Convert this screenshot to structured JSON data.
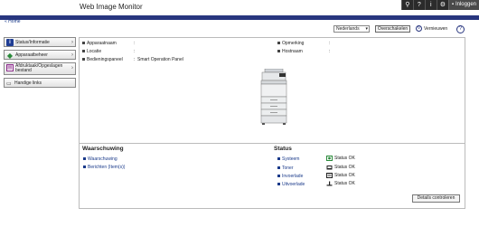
{
  "header": {
    "app_title": "Web Image Monitor",
    "icons": [
      "search-icon",
      "question-icon",
      "info-icon",
      "gear-icon",
      "user-icon"
    ],
    "login_label": "Inloggen"
  },
  "breadcrumb": {
    "home_label": "Home"
  },
  "toolbar": {
    "language": "Nederlands",
    "switch_label": "Overschakelen",
    "refresh_label": "Vernieuwen",
    "help_icon": "help-icon"
  },
  "sidebar": {
    "items": [
      {
        "label": "Status/Informatie",
        "icon": "info-icon"
      },
      {
        "label": "Apparaatbeheer",
        "icon": "device-icon"
      },
      {
        "label": "Afdruktaak/Opgeslagen bestand",
        "icon": "print-job-icon"
      }
    ],
    "links_label": "Handige links"
  },
  "device_info": {
    "rows": [
      {
        "label": "Apparaatnaam",
        "sep": ":",
        "value": ""
      },
      {
        "label": "Locatie",
        "sep": ":",
        "value": ""
      },
      {
        "label": "Bedieningspaneel",
        "sep": ":",
        "value": "Smart Operation Panel"
      },
      {
        "label": "Opmerking",
        "sep": ":",
        "value": ""
      },
      {
        "label": "Hostnaam",
        "sep": ":",
        "value": ""
      }
    ]
  },
  "warning": {
    "title": "Waarschuwing",
    "links": [
      "Waarschuwing",
      "Berichten (Item(s))"
    ]
  },
  "status": {
    "title": "Status",
    "items": [
      {
        "label": "Systeem",
        "value": "Status OK",
        "icon": "system-icon"
      },
      {
        "label": "Toner",
        "value": "Status OK",
        "icon": "toner-icon"
      },
      {
        "label": "Invoerlade",
        "value": "Status OK",
        "icon": "input-tray-icon"
      },
      {
        "label": "Uitvoerlade",
        "value": "Status OK",
        "icon": "output-tray-icon"
      }
    ],
    "details_label": "Details controleren"
  },
  "colors": {
    "header_bar": "#28367f",
    "link": "#1a3a8a"
  }
}
